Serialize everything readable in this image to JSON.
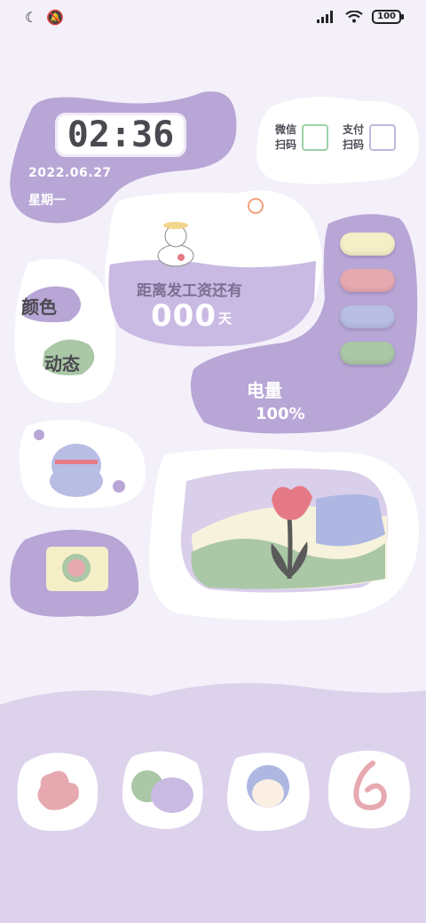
{
  "status_bar": {
    "battery": "100"
  },
  "clock": {
    "time": "02:36",
    "date": "2022.06.27",
    "weekday": "星期一"
  },
  "qr": {
    "wechat": {
      "line1": "微信",
      "line2": "扫码"
    },
    "alipay": {
      "line1": "支付",
      "line2": "扫码"
    }
  },
  "payday": {
    "label": "距离发工资还有",
    "number": "000",
    "unit": "天"
  },
  "color_widget": {
    "label1": "颜色",
    "label2": "动态"
  },
  "battery_widget": {
    "label": "电量",
    "value": "100%",
    "pill_colors": [
      "#f5efc7",
      "#e7a9b0",
      "#b7bde3",
      "#aac7a6"
    ]
  },
  "colors": {
    "purple": "#b8a6d6",
    "light_purple": "#ddd2ec",
    "white": "#ffffff"
  }
}
